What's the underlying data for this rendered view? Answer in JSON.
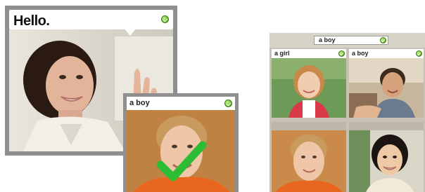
{
  "card_hello": {
    "caption": "Hello.",
    "photo": "woman-waving-photo",
    "status_icon": "green-check-dot-icon"
  },
  "card_boy": {
    "label": "a boy",
    "photo": "boy-portrait-photo",
    "overlay_icon": "green-checkmark-icon",
    "status_icon": "green-check-dot-icon"
  },
  "card_grid": {
    "prompt": "a boy",
    "cells": [
      {
        "label": "a girl",
        "photo": "girl-photo"
      },
      {
        "label": "a boy",
        "photo": "boy-classroom-photo"
      },
      {
        "label": "",
        "photo": "boy-portrait-photo"
      },
      {
        "label": "",
        "photo": "girl-smiling-photo"
      }
    ]
  }
}
